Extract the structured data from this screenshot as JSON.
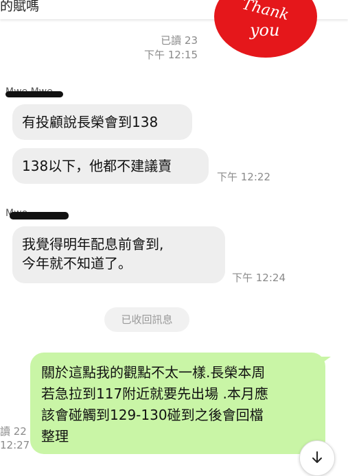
{
  "header": {
    "title": "的賦嗎"
  },
  "sticker": {
    "line1": "Thank",
    "line2": "you"
  },
  "messages": [
    {
      "read": "已讀 23",
      "time": "下午 12:15"
    },
    {
      "sender": "Mwe Mwe",
      "text": "有投顧說長榮會到138"
    },
    {
      "text": "138以下，他都不建議賣",
      "time": "下午 12:22"
    },
    {
      "sender": "Mwe",
      "text_lines": [
        "我覺得明年配息前會到,",
        "今年就不知道了。"
      ],
      "time": "下午 12:24"
    }
  ],
  "system": {
    "recalled": "已收回訊息"
  },
  "my_message": {
    "lines": [
      "關於這點我的觀點不太一樣.長榮本周",
      "若急拉到117附近就要先出場 .本月應",
      "該會碰觸到129-130碰到之後會回檔",
      "整理"
    ],
    "read": "讀 22",
    "time": "12:27"
  },
  "colors": {
    "my_bubble": "#c9f5a6",
    "their_bubble": "#eeeeee",
    "sticker": "#e5171b"
  },
  "icons": {
    "scroll": "arrow-down-icon"
  }
}
